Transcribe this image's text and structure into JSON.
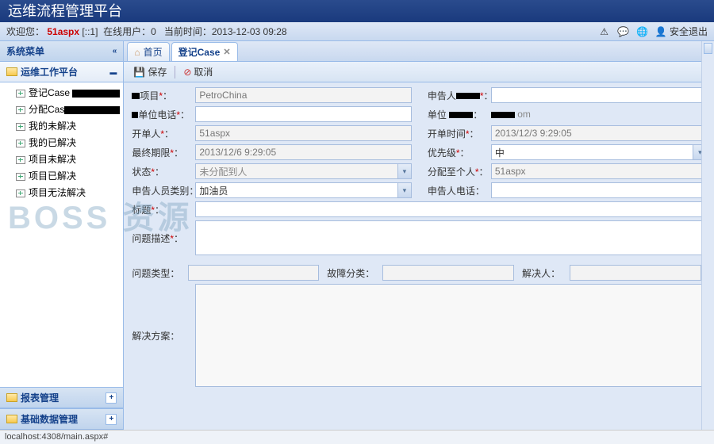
{
  "titlebar": {
    "title": "运维流程管理平台"
  },
  "statusbar": {
    "welcome": "欢迎您：",
    "user": "51aspx",
    "ip": "[::1]",
    "online_label": "在线用户：",
    "online_count": "0",
    "time_label": "当前时间：",
    "time_value": "2013-12-03 09:28",
    "logout": "安全退出"
  },
  "sidebar": {
    "title": "系统菜单",
    "root": "运维工作平台",
    "items": [
      {
        "label": "登记Case"
      },
      {
        "label": "分配Cas"
      },
      {
        "label": "我的未解决"
      },
      {
        "label": "我的已解决"
      },
      {
        "label": "项目未解决"
      },
      {
        "label": "项目已解决"
      },
      {
        "label": "项目无法解决"
      }
    ],
    "bottom": [
      {
        "label": "报表管理"
      },
      {
        "label": "基础数据管理"
      }
    ]
  },
  "tabs": {
    "home": "首页",
    "active": "登记Case"
  },
  "toolbar": {
    "save": "保存",
    "cancel": "取消"
  },
  "form": {
    "project_label": "项目",
    "project_value": "PetroChina",
    "reporter_label": "申告人",
    "unit_phone_label": "单位电话",
    "unit_label": "单位",
    "creator_label": "开单人",
    "creator_value": "51aspx",
    "create_time_label": "开单时间",
    "create_time_value": "2013/12/3 9:29:05",
    "deadline_label": "最终期限",
    "deadline_value": "2013/12/6 9:29:05",
    "priority_label": "优先级",
    "priority_value": "中",
    "status_label": "状态",
    "status_value": "未分配到人",
    "assignee_label": "分配至个人",
    "assignee_value": "51aspx",
    "reporter_type_label": "申告人员类别",
    "reporter_type_value": "加油员",
    "reporter_phone_label": "申告人电话",
    "title_label": "标题",
    "desc_label": "问题描述",
    "issue_type_label": "问题类型",
    "fault_class_label": "故障分类",
    "resolver_label": "解决人",
    "solution_label": "解决方案"
  },
  "watermark": "BOSS 资源",
  "footer": {
    "url": "localhost:4308/main.aspx#"
  }
}
